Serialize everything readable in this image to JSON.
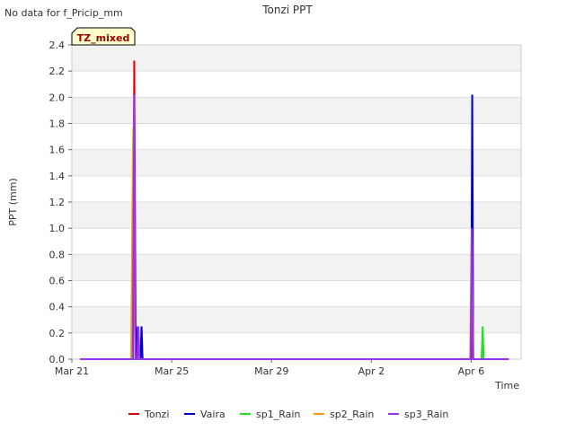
{
  "page": {
    "no_data_note": "No data for f_Pricip_mm",
    "site_badge": "TZ_mixed"
  },
  "chart_data": {
    "type": "line",
    "title": "Tonzi PPT",
    "xlabel": "Time",
    "ylabel": "PPT (mm)",
    "x_unit": "days since Mar 21 (date axis)",
    "xlim": [
      "Mar 21",
      "Apr 8"
    ],
    "ylim": [
      0.0,
      2.4
    ],
    "x_ticks": [
      {
        "label": "Mar 21",
        "date": "Mar 21"
      },
      {
        "label": "Mar 25",
        "date": "Mar 25"
      },
      {
        "label": "Mar 29",
        "date": "Mar 29"
      },
      {
        "label": "Apr 2",
        "date": "Apr 2"
      },
      {
        "label": "Apr 6",
        "date": "Apr 6"
      }
    ],
    "y_ticks": [
      "0.0",
      "0.2",
      "0.4",
      "0.6",
      "0.8",
      "1.0",
      "1.2",
      "1.4",
      "1.6",
      "1.8",
      "2.0",
      "2.2",
      "2.4"
    ],
    "grid": true,
    "legend_position": "bottom",
    "series": [
      {
        "name": "Tonzi",
        "color": "#dd0000",
        "points": [
          [
            "Mar 21 08:00",
            0
          ],
          [
            "Mar 23 10:30",
            0
          ],
          [
            "Mar 23 12:00",
            2.28
          ],
          [
            "Mar 23 13:30",
            0
          ],
          [
            "Apr 6 00:00",
            0
          ],
          [
            "Apr 6 01:00",
            1.0
          ],
          [
            "Apr 6 02:00",
            0
          ],
          [
            "Apr 7 12:00",
            0
          ]
        ]
      },
      {
        "name": "Vaira",
        "color": "#0000cc",
        "points": [
          [
            "Mar 21 08:00",
            0
          ],
          [
            "Mar 23 10:30",
            0
          ],
          [
            "Mar 23 12:00",
            1.25
          ],
          [
            "Mar 23 13:00",
            0
          ],
          [
            "Mar 23 14:00",
            0.25
          ],
          [
            "Mar 23 15:00",
            0
          ],
          [
            "Mar 23 18:00",
            0
          ],
          [
            "Mar 23 19:00",
            0.25
          ],
          [
            "Mar 23 20:00",
            0
          ],
          [
            "Apr 6 00:00",
            0
          ],
          [
            "Apr 6 01:00",
            2.02
          ],
          [
            "Apr 6 02:00",
            0
          ],
          [
            "Apr 7 12:00",
            0
          ]
        ]
      },
      {
        "name": "sp1_Rain",
        "color": "#22dd22",
        "points": [
          [
            "Mar 21 08:00",
            0
          ],
          [
            "Apr 6 10:00",
            0
          ],
          [
            "Apr 6 11:00",
            0.25
          ],
          [
            "Apr 6 12:00",
            0
          ],
          [
            "Apr 7 12:00",
            0
          ]
        ]
      },
      {
        "name": "sp2_Rain",
        "color": "#ff9900",
        "points": [
          [
            "Mar 21 08:00",
            0
          ],
          [
            "Mar 23 09:00",
            0
          ],
          [
            "Mar 23 11:00",
            1.77
          ],
          [
            "Mar 23 13:00",
            0
          ],
          [
            "Apr 5 23:00",
            0
          ],
          [
            "Apr 6 00:30",
            0.98
          ],
          [
            "Apr 6 02:00",
            0
          ],
          [
            "Apr 7 12:00",
            0
          ]
        ]
      },
      {
        "name": "sp3_Rain",
        "color": "#9933ee",
        "points": [
          [
            "Mar 21 08:00",
            0
          ],
          [
            "Mar 23 10:30",
            0
          ],
          [
            "Mar 23 12:00",
            2.02
          ],
          [
            "Mar 23 13:00",
            0
          ],
          [
            "Mar 23 15:00",
            0
          ],
          [
            "Mar 23 16:00",
            0.25
          ],
          [
            "Mar 23 17:00",
            0
          ],
          [
            "Apr 5 23:30",
            0
          ],
          [
            "Apr 6 00:30",
            1.0
          ],
          [
            "Apr 6 01:30",
            0
          ],
          [
            "Apr 7 12:00",
            0
          ]
        ]
      }
    ]
  }
}
